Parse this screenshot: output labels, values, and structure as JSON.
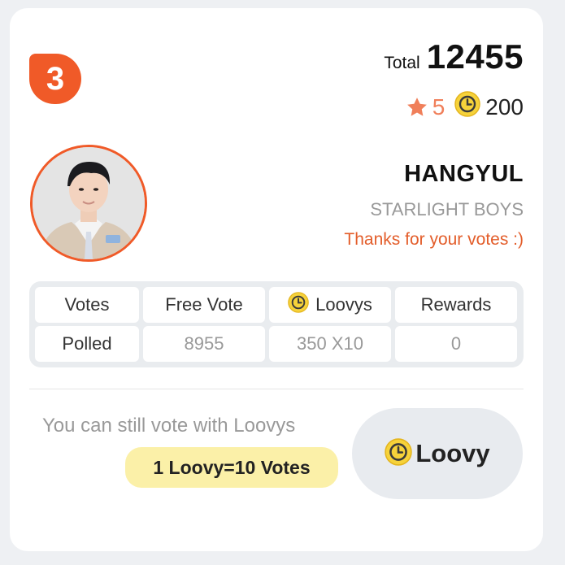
{
  "rank": "3",
  "total": {
    "label": "Total",
    "value": "12455"
  },
  "stats": {
    "stars": "5",
    "coins": "200"
  },
  "idol": {
    "name": "HANGYUL",
    "group": "STARLIGHT BOYS",
    "thanks": "Thanks for your votes :)"
  },
  "table": {
    "headers": [
      "Votes",
      "Free Vote",
      "Loovys",
      "Rewards"
    ],
    "values": [
      "Polled",
      "8955",
      "350 X10",
      "0"
    ]
  },
  "cta": {
    "hint": "You can still vote with Loovys",
    "rate": "1 Loovy=10 Votes",
    "button_label": "Loovy"
  },
  "colors": {
    "accent": "#f05a28",
    "coin": "#f6d23a",
    "rate_bg": "#fbf0a8"
  },
  "icons": {
    "badge": "rank-badge",
    "star": "star-icon",
    "coin": "loovy-coin-icon"
  }
}
